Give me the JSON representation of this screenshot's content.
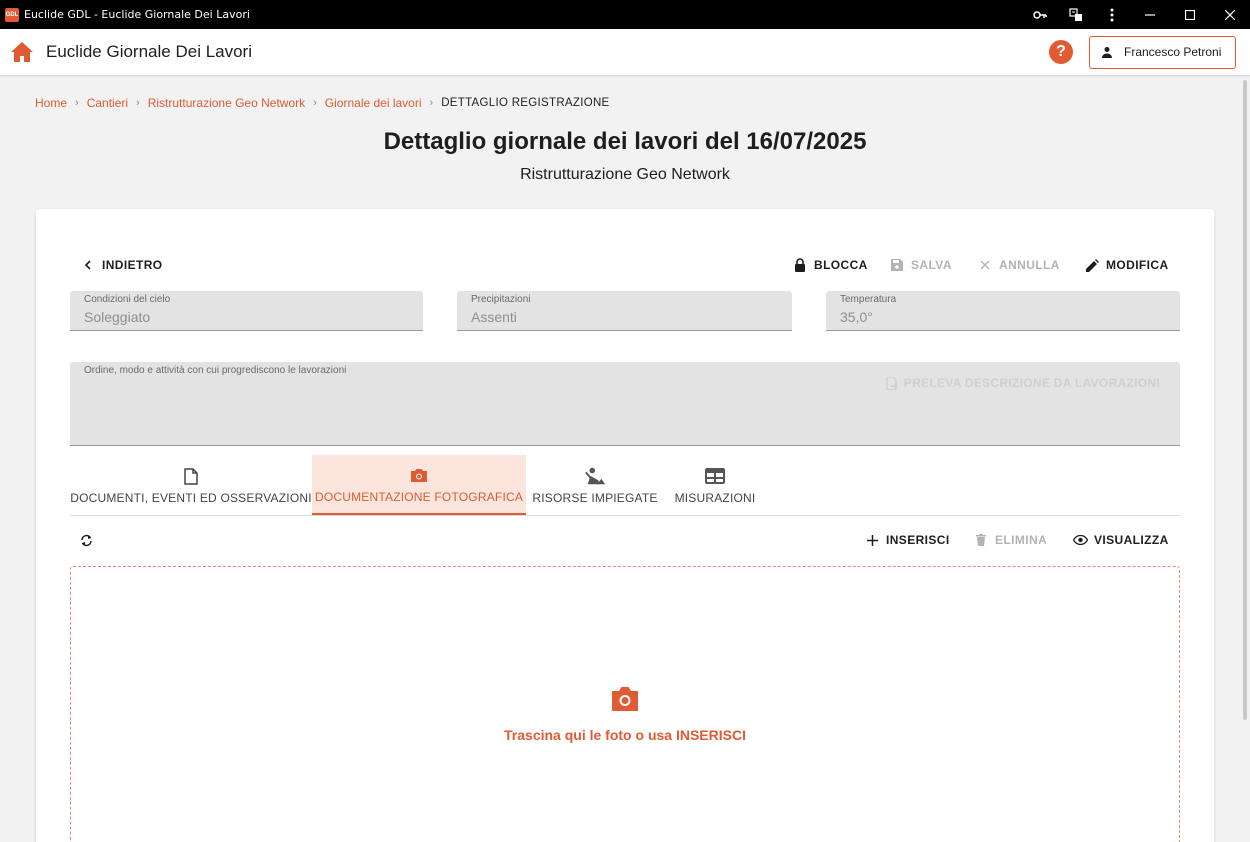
{
  "window": {
    "app_icon_text": "GDL",
    "title": "Euclide GDL - Euclide Giornale Dei Lavori"
  },
  "appbar": {
    "app_name": "Euclide Giornale Dei Lavori",
    "help_symbol": "?",
    "user_name": "Francesco Petroni"
  },
  "breadcrumb": {
    "items": [
      "Home",
      "Cantieri",
      "Ristrutturazione Geo Network",
      "Giornale dei lavori"
    ],
    "current": "DETTAGLIO REGISTRAZIONE",
    "separator": "›"
  },
  "page": {
    "title": "Dettaglio giornale dei lavori del 16/07/2025",
    "subtitle": "Ristrutturazione Geo Network"
  },
  "toolbar": {
    "back_label": "INDIETRO",
    "lock_label": "BLOCCA",
    "save_label": "SALVA",
    "cancel_label": "ANNULLA",
    "edit_label": "MODIFICA"
  },
  "fields": {
    "sky": {
      "label": "Condizioni del cielo",
      "value": "Soleggiato"
    },
    "precipitation": {
      "label": "Precipitazioni",
      "value": "Assenti"
    },
    "temperature": {
      "label": "Temperatura",
      "value": "35,0°"
    },
    "description": {
      "label": "Ordine, modo e attività con cui progrediscono le lavorazioni",
      "action_label": "PRELEVA DESCRIZIONE DA LAVORAZIONI"
    }
  },
  "tabs": [
    {
      "label": "DOCUMENTI, EVENTI ED OSSERVAZIONI",
      "icon": "document-icon"
    },
    {
      "label": "DOCUMENTAZIONE FOTOGRAFICA",
      "icon": "camera-icon",
      "active": true
    },
    {
      "label": "RISORSE IMPIEGATE",
      "icon": "worker-icon"
    },
    {
      "label": "MISURAZIONI",
      "icon": "table-icon"
    }
  ],
  "photos_toolbar": {
    "insert_label": "INSERISCI",
    "delete_label": "ELIMINA",
    "view_label": "VISUALIZZA"
  },
  "dropzone": {
    "text": "Trascina qui le foto o usa INSERISCI"
  },
  "colors": {
    "accent": "#e05a33",
    "active_tab_bg": "#fbe5dd",
    "disabled": "#b3b3b3"
  }
}
